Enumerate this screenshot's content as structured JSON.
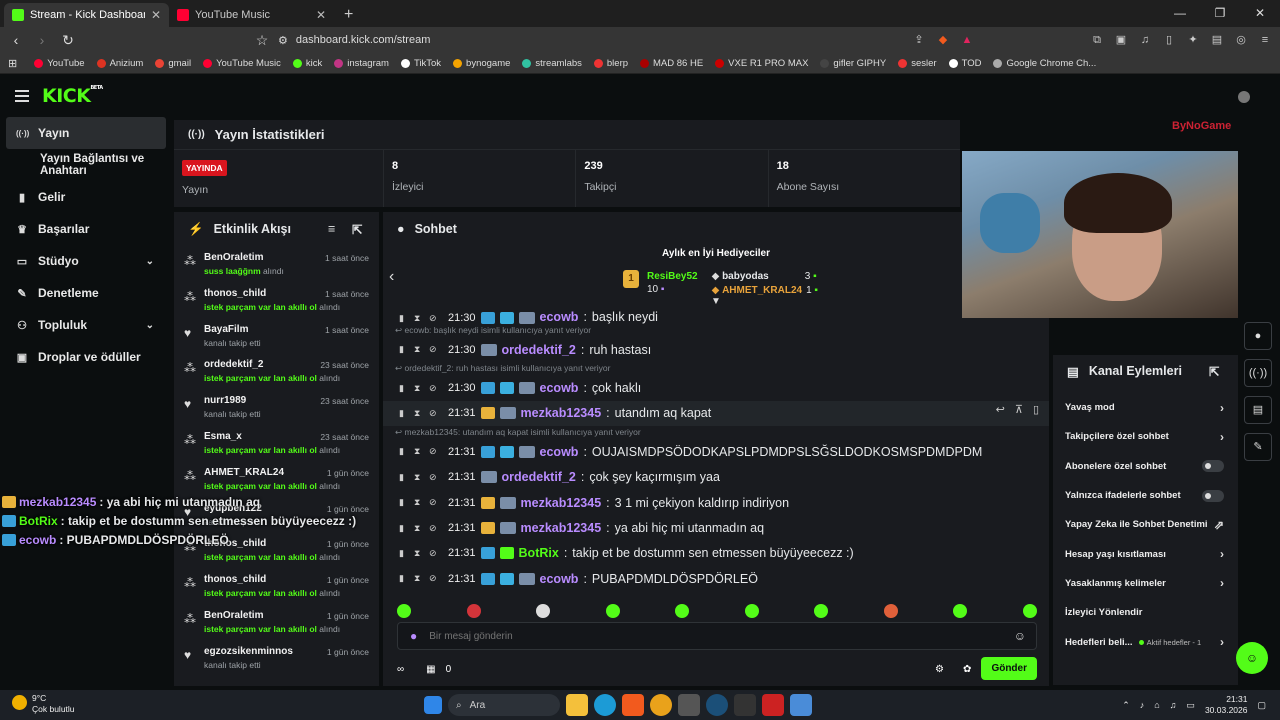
{
  "browser": {
    "tabs": [
      {
        "title": "Stream - Kick Dashboard",
        "color": "#53fc18",
        "active": true
      },
      {
        "title": "YouTube Music",
        "color": "#ff0033",
        "active": false
      }
    ],
    "url": "dashboard.kick.com/stream",
    "bookmarks": [
      "YouTube",
      "Anizium",
      "gmail",
      "YouTube Music",
      "kick",
      "instagram",
      "TikTok",
      "bynogame",
      "streamlabs",
      "blerp",
      "MAD 86 HE",
      "VXE R1 PRO MAX",
      "gifler GIPHY",
      "sesler",
      "TOD",
      "Google Chrome Ch..."
    ]
  },
  "sidebar": {
    "items": [
      {
        "label": "Yayın",
        "icon": "broadcast-icon",
        "active": true
      },
      {
        "label": "Yayın Bağlantısı ve Anahtarı",
        "sub": true
      },
      {
        "label": "Gelir",
        "icon": "chart-icon"
      },
      {
        "label": "Başarılar",
        "icon": "trophy-icon"
      },
      {
        "label": "Stüdyo",
        "icon": "studio-icon",
        "expand": true
      },
      {
        "label": "Denetleme",
        "icon": "wrench-icon"
      },
      {
        "label": "Topluluk",
        "icon": "people-icon",
        "expand": true
      },
      {
        "label": "Droplar ve ödüller",
        "icon": "drops-icon"
      }
    ]
  },
  "stats": {
    "title": "Yayın İstatistikleri",
    "live_badge": "YAYINDA",
    "stream_label": "Yayın",
    "viewers_value": "8",
    "viewers_label": "İzleyici",
    "followers_value": "239",
    "followers_label": "Takipçi",
    "subs_value": "18",
    "subs_label": "Abone Sayısı"
  },
  "feed": {
    "title": "Etkinlik Akışı",
    "items": [
      {
        "name": "BenOraletim",
        "sub_green": "suss laağğnm",
        "sub_rest": " alındı",
        "time": "1 saat önce",
        "icon": "gift-icon"
      },
      {
        "name": "thonos_child",
        "sub_green": "istek parçam var lan akıllı ol",
        "sub_rest": " alındı",
        "time": "1 saat önce",
        "icon": "gift-icon"
      },
      {
        "name": "BayaFilm",
        "sub_green": "",
        "sub_rest": "kanalı takip etti",
        "time": "1 saat önce",
        "icon": "heart-icon"
      },
      {
        "name": "ordedektif_2",
        "sub_green": "istek parçam var lan akıllı ol",
        "sub_rest": " alındı",
        "time": "23 saat önce",
        "icon": "gift-icon"
      },
      {
        "name": "nurr1989",
        "sub_green": "",
        "sub_rest": "kanalı takip etti",
        "time": "23 saat önce",
        "icon": "heart-icon"
      },
      {
        "name": "Esma_x",
        "sub_green": "istek parçam var lan akıllı ol",
        "sub_rest": " alındı",
        "time": "23 saat önce",
        "icon": "gift-icon"
      },
      {
        "name": "AHMET_KRAL24",
        "sub_green": "istek parçam var lan akıllı ol",
        "sub_rest": " alındı",
        "time": "1 gün önce",
        "icon": "gift-icon"
      },
      {
        "name": "eyupben122",
        "sub_green": "",
        "sub_rest": "kanalı takip etti",
        "time": "1 gün önce",
        "icon": "heart-icon"
      },
      {
        "name": "thonos_child",
        "sub_green": "istek parçam var lan akıllı ol",
        "sub_rest": " alındı",
        "time": "1 gün önce",
        "icon": "gift-icon"
      },
      {
        "name": "thonos_child",
        "sub_green": "istek parçam var lan akıllı ol",
        "sub_rest": " alındı",
        "time": "1 gün önce",
        "icon": "gift-icon"
      },
      {
        "name": "BenOraletim",
        "sub_green": "istek parçam var lan akıllı ol",
        "sub_rest": " alındı",
        "time": "1 gün önce",
        "icon": "gift-icon"
      },
      {
        "name": "egzozsikenminnos",
        "sub_green": "",
        "sub_rest": "kanalı takip etti",
        "time": "1 gün önce",
        "icon": "heart-icon"
      }
    ]
  },
  "chat": {
    "title": "Sohbet",
    "gifters_title": "Aylık en İyi Hediyeciler",
    "top_gifter": {
      "name": "ResiBey52",
      "count": "10",
      "rank": "1"
    },
    "gifters": [
      {
        "name": "babyodas",
        "count": "3"
      },
      {
        "name": "AHMET_KRAL24",
        "count": "1"
      }
    ],
    "messages": [
      {
        "type": "msg",
        "time": "21:30",
        "user": "ecowb",
        "text": "başlık neydi",
        "color": "#b98cff",
        "cut": true
      },
      {
        "type": "reply",
        "text": "ecowb: başlık neydi isimli kullanıcıya yanıt veriyor"
      },
      {
        "type": "msg",
        "time": "21:30",
        "user": "ordedektif_2",
        "text": "ruh hastası",
        "color": "#b98cff"
      },
      {
        "type": "reply",
        "text": "ordedektif_2: ruh hastası isimli kullanıcıya yanıt veriyor"
      },
      {
        "type": "msg",
        "time": "21:30",
        "user": "ecowb",
        "text": "çok haklı",
        "color": "#b98cff"
      },
      {
        "type": "msg",
        "time": "21:31",
        "user": "mezkab12345",
        "text": "utandım aq kapat",
        "color": "#b98cff",
        "hover": true
      },
      {
        "type": "reply",
        "text": "mezkab12345: utandım aq kapat isimli kullanıcıya yanıt veriyor"
      },
      {
        "type": "msg",
        "time": "21:31",
        "user": "ecowb",
        "text": "OUJAISMDPSÖDODKAPSLPDMDPSLSĞSLDODKOSMSPDMDPDM",
        "color": "#b98cff"
      },
      {
        "type": "msg",
        "time": "21:31",
        "user": "ordedektif_2",
        "text": "çok şey kaçırmışım yaa",
        "color": "#b98cff"
      },
      {
        "type": "msg",
        "time": "21:31",
        "user": "mezkab12345",
        "text": "3 1 mi çekiyon kaldırıp indiriyon",
        "color": "#b98cff"
      },
      {
        "type": "msg",
        "time": "21:31",
        "user": "mezkab12345",
        "text": "ya abi hiç mi utanmadın aq",
        "color": "#b98cff"
      },
      {
        "type": "msg",
        "time": "21:31",
        "user": "BotRix",
        "text": "takip et be dostumm sen etmessen büyüyeecezz :)",
        "color": "#53fc18"
      },
      {
        "type": "msg",
        "time": "21:31",
        "user": "ecowb",
        "text": "PUBAPDMDLDÖSPDÖRLEÖ",
        "color": "#b98cff"
      }
    ],
    "input_placeholder": "Bir mesaj gönderin",
    "points": "0",
    "send_label": "Gönder"
  },
  "webcam": {
    "watermark": "ByNoGame"
  },
  "actions": {
    "title": "Kanal Eylemleri",
    "items": [
      {
        "label": "Yavaş mod",
        "ctrl": "arrow"
      },
      {
        "label": "Takipçilere özel sohbet",
        "ctrl": "arrow"
      },
      {
        "label": "Abonelere özel sohbet",
        "ctrl": "toggle"
      },
      {
        "label": "Yalnızca ifadelerle sohbet",
        "ctrl": "toggle"
      },
      {
        "label": "Yapay Zeka ile Sohbet Denetimi",
        "ctrl": "external"
      },
      {
        "label": "Hesap yaşı kısıtlaması",
        "ctrl": "arrow"
      },
      {
        "label": "Yasaklanmış kelimeler",
        "ctrl": "arrow"
      },
      {
        "label": "İzleyici Yönlendir",
        "ctrl": "none"
      },
      {
        "label": "Hedefleri beli...",
        "ctrl": "arrow",
        "note": "Aktif hedefler - 1"
      }
    ]
  },
  "overlay": [
    {
      "user": "mezkab12345",
      "text": " : ya abi hiç mi utanmadın aq",
      "color": "#b98cff"
    },
    {
      "user": "BotRix",
      "text": " : takip et be dostumm sen etmessen büyüyeecezz :)",
      "color": "#53fc18"
    },
    {
      "user": "ecowb",
      "text": " : PUBAPDMDLDÖSPDÖRLEÖ",
      "color": "#b98cff"
    }
  ],
  "taskbar": {
    "temp": "9°C",
    "weather": "Çok bulutlu",
    "search": "Ara",
    "time": "21:31",
    "date": "30.03.2026"
  }
}
